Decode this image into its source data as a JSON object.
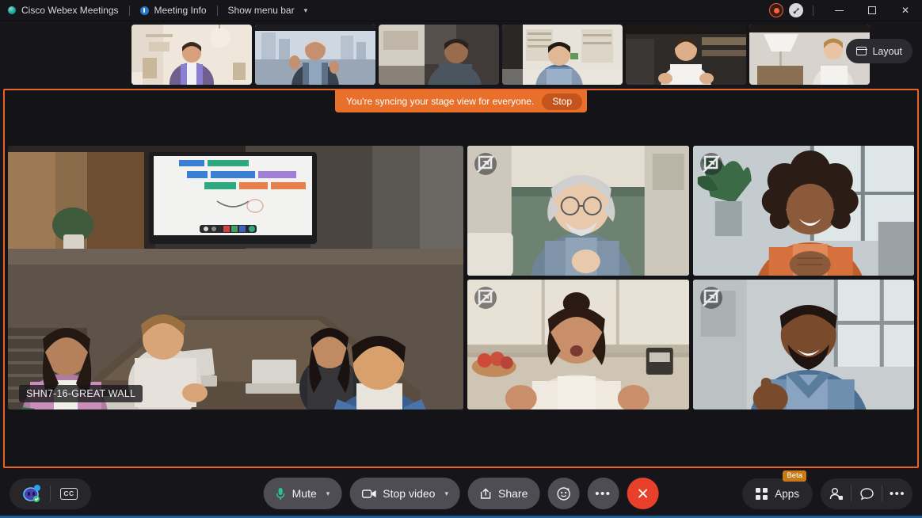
{
  "titlebar": {
    "app_name": "Cisco Webex Meetings",
    "meeting_info": "Meeting Info",
    "show_menu_bar": "Show menu bar",
    "caret": "⌵",
    "record_icon": "record-icon",
    "audio_icon": "audio-connection-icon",
    "minimize": "minimize-icon",
    "maximize": "maximize-icon",
    "close": "✕"
  },
  "filmstrip": {
    "layout_label": "Layout",
    "participants": [
      {
        "name": "participant-1",
        "skin": "#d8a07c",
        "shirt": "#8b7fd4",
        "bg": "#efe6dc"
      },
      {
        "name": "participant-2",
        "skin": "#c49070",
        "shirt": "#5b6f86",
        "bg": "#cfd8e2"
      },
      {
        "name": "participant-3",
        "skin": "#9a6b4c",
        "shirt": "#4a5560",
        "bg": "#403a38"
      },
      {
        "name": "participant-4",
        "skin": "#e0b896",
        "shirt": "#6d90b8",
        "bg": "#e8e3da"
      },
      {
        "name": "participant-5",
        "skin": "#dcae8a",
        "shirt": "#f2f0ec",
        "bg": "#2e2b28"
      },
      {
        "name": "participant-6",
        "skin": "#e8c4a4",
        "shirt": "#f4f2ef",
        "bg": "#d8d4cd"
      }
    ]
  },
  "stage": {
    "sync_message": "You're syncing your stage view for everyone.",
    "stop_label": "Stop",
    "main_video": {
      "label": "SHN7-16-GREAT WALL",
      "name": "conference-room-video"
    },
    "pin_icon": "pin-to-stage-icon",
    "grid_videos": [
      {
        "name": "video-tile-1",
        "skin": "#e8c9ac",
        "hair": "#cfcfcf",
        "shirt": "#7f94a8",
        "bg": "#d8d2c6",
        "wall": "#6e8272"
      },
      {
        "name": "video-tile-2",
        "skin": "#8a5a3a",
        "hair": "#2b1d16",
        "shirt": "#d6713e",
        "bg": "#cfd6d8",
        "wall": "#b8bfc2"
      },
      {
        "name": "video-tile-3",
        "skin": "#c98f6a",
        "hair": "#2a1a12",
        "shirt": "#efe9df",
        "bg": "#ded6c8",
        "wall": "#cfc5b4"
      },
      {
        "name": "video-tile-4",
        "skin": "#7a4a2c",
        "hair": "#201410",
        "shirt": "#6f8fae",
        "bg": "#cfd4d6",
        "wall": "#b6bcc0"
      }
    ]
  },
  "bottombar": {
    "assistant_icon": "webex-assistant-icon",
    "cc_label": "CC",
    "cc_icon": "closed-captions-icon",
    "mute_label": "Mute",
    "mute_icon": "microphone-icon",
    "stop_video_label": "Stop video",
    "video_icon": "camera-icon",
    "share_label": "Share",
    "share_icon": "share-screen-icon",
    "reactions_icon": "reactions-smiley-icon",
    "more_icon": "more-options-icon",
    "more_glyph": "•••",
    "end_label": "✕",
    "end_icon": "end-meeting-icon",
    "apps_label": "Apps",
    "apps_icon": "apps-grid-icon",
    "beta_badge": "Beta",
    "participants_icon": "participants-icon",
    "chat_icon": "chat-bubble-icon",
    "options_icon": "more-options-icon",
    "caret": "⌵"
  },
  "colors": {
    "accent_orange": "#e8632b",
    "banner_orange": "#e8702a",
    "end_red": "#e8402a",
    "beta_amber": "#c97a18",
    "bottom_accent_blue": "#1d5d99"
  }
}
